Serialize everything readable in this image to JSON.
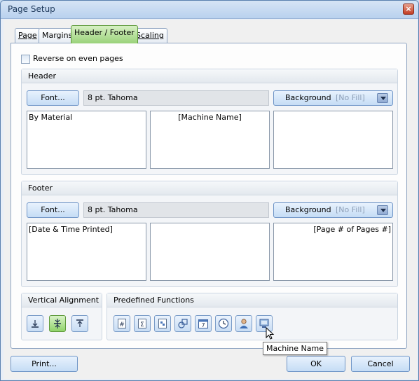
{
  "window": {
    "title": "Page Setup",
    "close_glyph": "×"
  },
  "tabs": [
    {
      "label": "Page",
      "active": false
    },
    {
      "label": "Margins",
      "active": false
    },
    {
      "label": "Header / Footer",
      "active": true
    },
    {
      "label": "Scaling",
      "active": false
    }
  ],
  "reverse_checkbox": {
    "label": "Reverse on even pages",
    "checked": false
  },
  "header": {
    "title": "Header",
    "font_button": "Font...",
    "font_value": "8 pt. Tahoma",
    "background_button": "Background",
    "background_value": "[No Fill]",
    "left_text": "By Material",
    "center_text": "[Machine Name]",
    "right_text": ""
  },
  "footer": {
    "title": "Footer",
    "font_button": "Font...",
    "font_value": "8 pt. Tahoma",
    "background_button": "Background",
    "background_value": "[No Fill]",
    "left_text": "[Date & Time Printed]",
    "center_text": "",
    "right_text": "[Page # of Pages #]"
  },
  "vertical_alignment": {
    "title": "Vertical Alignment",
    "buttons": [
      {
        "icon": "align-bottom-icon",
        "selected": false
      },
      {
        "icon": "align-center-icon",
        "selected": true
      },
      {
        "icon": "align-top-icon",
        "selected": false
      }
    ]
  },
  "predefined_functions": {
    "title": "Predefined Functions",
    "buttons": [
      {
        "icon": "page-number-icon",
        "glyph": "#"
      },
      {
        "icon": "page-count-icon",
        "glyph": "Σ"
      },
      {
        "icon": "date-time-printed-icon"
      },
      {
        "icon": "shapes-icon"
      },
      {
        "icon": "calendar-icon",
        "glyph": "7"
      },
      {
        "icon": "clock-icon"
      },
      {
        "icon": "user-icon"
      },
      {
        "icon": "machine-name-icon"
      }
    ]
  },
  "tooltip": "Machine Name",
  "buttons": {
    "print": "Print...",
    "ok": "OK",
    "cancel": "Cancel"
  },
  "colors": {
    "active_tab": "#9ad27a",
    "button": "#c5dcf5",
    "accent": "#6f95c7"
  }
}
